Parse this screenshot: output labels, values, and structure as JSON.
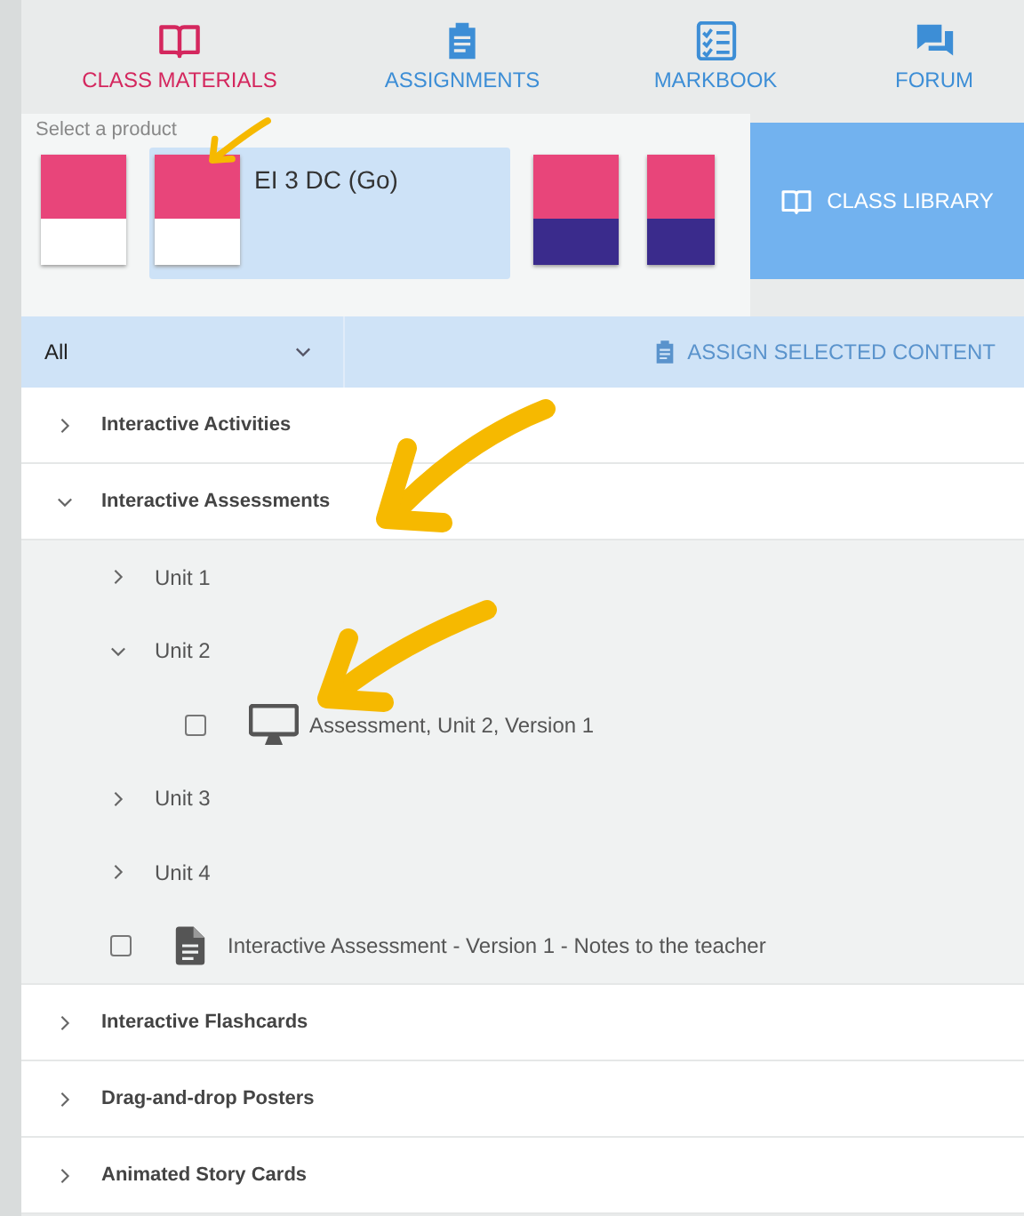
{
  "nav_tabs": [
    {
      "label": "CLASS MATERIALS",
      "kind": "book",
      "selected": true
    },
    {
      "label": "ASSIGNMENTS",
      "kind": "clipboard",
      "selected": false
    },
    {
      "label": "MARKBOOK",
      "kind": "checklist",
      "selected": false
    },
    {
      "label": "FORUM",
      "kind": "chat",
      "selected": false
    }
  ],
  "product_picker": {
    "label": "Select a product",
    "products": [
      {
        "kind": "resources",
        "selected": false
      },
      {
        "kind": "components",
        "selected": true,
        "title": "EI 3 DC (Go)"
      },
      {
        "kind": "book",
        "selected": false
      },
      {
        "kind": "reader",
        "selected": false
      }
    ]
  },
  "class_library_button": "CLASS LIBRARY",
  "filter": {
    "value": "All"
  },
  "assign_button": {
    "label": "ASSIGN SELECTED CONTENT",
    "disabled": true
  },
  "categories": [
    {
      "label": "Interactive Activities",
      "expanded": false
    },
    {
      "label": "Interactive Assessments",
      "expanded": true,
      "children": [
        {
          "kind": "folder",
          "label": "Unit 1",
          "expanded": false
        },
        {
          "kind": "folder",
          "label": "Unit 2",
          "expanded": true,
          "children": [
            {
              "kind": "interactive",
              "label": "Assessment, Unit 2, Version 1",
              "checked": false
            }
          ]
        },
        {
          "kind": "folder",
          "label": "Unit 3",
          "expanded": false
        },
        {
          "kind": "folder",
          "label": "Unit 4",
          "expanded": false
        },
        {
          "kind": "document",
          "label": "Interactive Assessment - Version 1 - Notes to the teacher",
          "checked": false
        }
      ]
    },
    {
      "label": "Interactive Flashcards",
      "expanded": false
    },
    {
      "label": "Drag-and-drop Posters",
      "expanded": false
    },
    {
      "label": "Animated Story Cards",
      "expanded": false
    }
  ]
}
